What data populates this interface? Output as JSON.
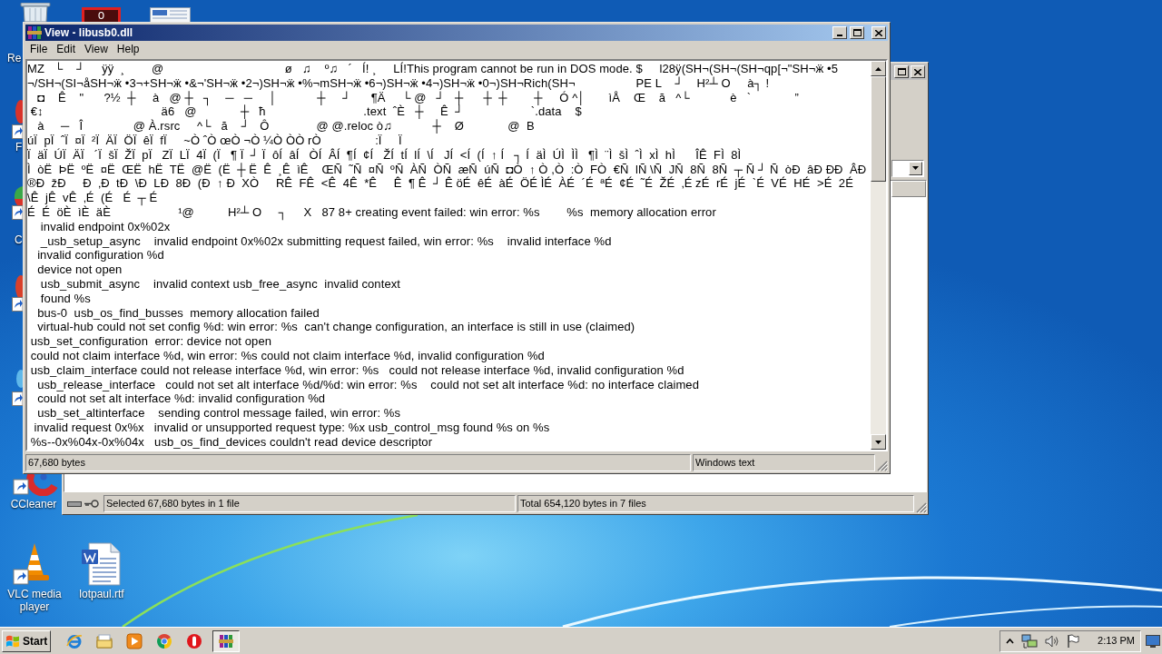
{
  "desktop_icons": [
    {
      "kind": "recycle",
      "label": "Re"
    },
    {
      "kind": "edge_red",
      "label": "F"
    },
    {
      "kind": "edge_green",
      "label": "C"
    },
    {
      "kind": "edge_orange"
    },
    {
      "kind": "edge_pale"
    },
    {
      "kind": "cleaner",
      "label": "CCleaner"
    },
    {
      "kind": "cone",
      "label": "VLC media player"
    },
    {
      "kind": "document",
      "label": "lotpaul.rtf"
    }
  ],
  "background_window": {
    "status_bar": [
      "Selected 67,680 bytes in 1 file",
      "Total 654,120 bytes in 7 files"
    ]
  },
  "viewer_window": {
    "title": "View - libusb0.dll",
    "menu": [
      "File",
      "Edit",
      "View",
      "Help"
    ],
    "lines": [
      "MZ   └    ┘     ÿÿ  ¸        @                                    ø   ♫    º♫   ´   Í! ¸     LÍ!This program cannot be run in DOS mode. $     l28ÿ(SH¬(SH¬(SH¬qp[¬\"SH¬ӝ •5",
      "¬/SH¬(SI¬åSH¬ӝ •3¬+SH¬ӝ •&¬'SH¬ӝ •2¬)SH¬ӝ •%¬mSH¬ӝ •6¬)SH¬ӝ •4¬)SH¬ӝ •0¬)SH¬Rich(SH¬                  PE L    ┘    H²┴ O     à┐ !",
      "   ◘    Ê    \"      ?½  ┼     à   @ ┼   ┐    ─   ─     │            ┼     ┘      ¶Ä     └ @   ┘   ┼      ┼  ┼        ┼     Ó ^│       ìÅ    Œ    ă   ^└            è   `             ”",
      " €↕                                   ä6   @             ┼   ћ                             .text  ˆÈ   ┼     Ê  ┘                    `.data    $",
      "   à     ─   Î               @ À.rsrc     ^└   ă    ┘   Ô              @ @.reloc ò♫            ┼    Ø             @  B",
      "úÏ  pÏ  ˆÏ  ¤Ï  ²Ï  ÄÏ  ÖÏ  êÏ  fÏ     ~Ò ˆÒ œÒ ¬Ò ¼Ò ÒÒ rÒ                :Ï     Ï",
      "Ï  äÏ  ÚÏ  ÄÏ   ´Ï  šÏ  ŽÏ  pÏ   ZÏ  LÏ  4Ï  (Ï   ¶ Ï  ┘ Ï  ôÍ  âÍ   ÒÍ  ÂÍ  ¶Í  ¢Í   ŽÍ  tÍ  lÍ  \\Í   JÍ  <Í  (Í  ↑ Í   ┐ Í  äÌ  ÚÌ  ÌÌ   ¶Ì  ¨Ì  šÌ  ˆÌ  xÌ  hÌ      ÎÊ  FÌ  8Ì",
      "Ì  òË  ÞË  ºË  ¤Ë  ŒË  hË  TË  @Ë  (Ë  ┼ Ë  Ê  ¸Ê  ìÊ    ŒÑ  ˜Ñ  ¤Ñ  ºÑ  ÀÑ  ÒÑ  æÑ  úÑ  ◘Ò  ↑ Ò ,Ò  :Ò  FÒ  €Ñ  lÑ \\Ñ  JÑ  8Ñ  8Ñ  ┬ Ñ ┘ Ñ  òÐ  âÐ ÐÐ  ÂÐ",
      "®Ð  žÐ     Ð  ‚Ð  tÐ  \\Ð  LÐ  8Ð  (Ð  ↑ Ð  XÒ     RÊ  FÊ  <Ê  4Ê  *Ê     Ê  ¶ Ê  ┘ Ê öÉ  êÉ  àÉ  ÖÉ ÌÉ  ÀÉ  ´É  ªÉ  ¢É  ˜É  ŽÉ  ‚É zÉ  rÉ  jÉ  `É  VÉ  HÉ  >É  2É",
      "\\Ê  jÊ  vÊ  ‚É  (É   É  ┬ É",
      "É  É  öÈ  ìÈ  äÈ                    ¹@          H²┴ O     ┐     X   87 8+ creating event failed: win error: %s        %s  memory allocation error",
      "    invalid endpoint 0x%02x",
      "    _usb_setup_async    invalid endpoint 0x%02x submitting request failed, win error: %s    invalid interface %d",
      "   invalid configuration %d",
      "   device not open",
      "    usb_submit_async    invalid context usb_free_async  invalid context",
      "    found %s",
      "   bus-0  usb_os_find_busses  memory allocation failed",
      "   virtual-hub could not set config %d: win error: %s  can't change configuration, an interface is still in use (claimed)",
      " usb_set_configuration  error: device not open",
      " could not claim interface %d, win error: %s could not claim interface %d, invalid configuration %d",
      " usb_claim_interface could not release interface %d, win error: %s   could not release interface %d, invalid configuration %d",
      "   usb_release_interface   could not set alt interface %d/%d: win error: %s    could not set alt interface %d: no interface claimed",
      "   could not set alt interface %d: invalid configuration %d",
      "   usb_set_altinterface    sending control message failed, win error: %s",
      "  invalid request 0x%x   invalid or unsupported request type: %x usb_control_msg found %s on %s",
      " %s--0x%04x-0x%04x   usb_os_find_devices couldn't read device descriptor"
    ],
    "status_bar": [
      "67,680 bytes",
      "Windows text"
    ]
  },
  "taskbar": {
    "start": "Start",
    "tasks": [
      {
        "selected": true
      }
    ],
    "clock": "2:13 PM"
  }
}
